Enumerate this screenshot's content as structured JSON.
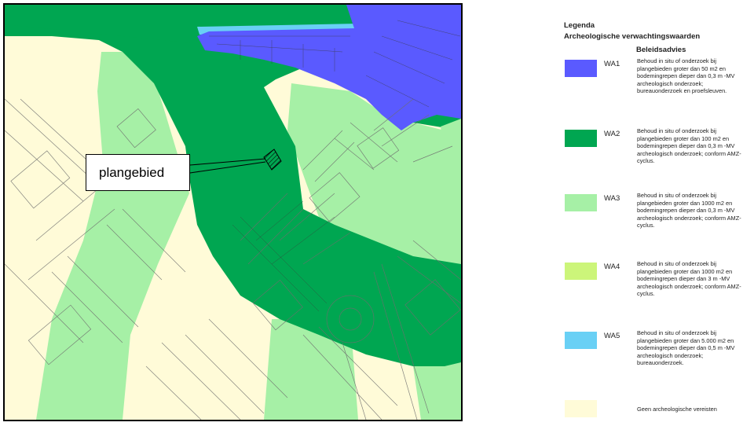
{
  "map": {
    "callout_label": "plangebied",
    "colors": {
      "base": "#fffbd8",
      "wa1": "#5a5aff",
      "wa2": "#00a651",
      "wa3": "#a6f0a6",
      "wa5": "#69d0f5",
      "lines": "#6e6e6e",
      "hatch": "#000000"
    }
  },
  "legend": {
    "title": "Legenda",
    "subtitle": "Archeologische verwachtingswaarden",
    "column_header": "Beleidsadvies",
    "items": [
      {
        "code": "WA1",
        "color": "#5a5aff",
        "description": "Behoud in situ of onderzoek bij plangebieden groter dan 50 m2 en bodemingrepen dieper dan 0,3 m -MV archeologisch onderzoek; bureauonderzoek en proefsleuven."
      },
      {
        "code": "WA2",
        "color": "#00a651",
        "description": "Behoud in situ of onderzoek bij plangebieden groter dan 100 m2 en bodemingrepen dieper dan 0,3 m -MV archeologisch onderzoek; conform AMZ-cyclus."
      },
      {
        "code": "WA3",
        "color": "#a6f0a6",
        "description": "Behoud in situ of onderzoek bij plangebieden groter dan 1000 m2 en bodemingrepen dieper dan 0,3 m -MV archeologisch onderzoek; conform AMZ-cyclus."
      },
      {
        "code": "WA4",
        "color": "#ccf57a",
        "description": "Behoud in situ of onderzoek bij plangebieden groter dan 1000 m2 en bodemingrepen dieper dan 3 m -MV archeologisch onderzoek; conform AMZ-cyclus."
      },
      {
        "code": "WA5",
        "color": "#69d0f5",
        "description": "Behoud in situ of onderzoek bij plangebieden groter dan 5.000 m2 en bodemingrepen dieper dan 0,5 m -MV archeologisch onderzoek; bureauonderzoek."
      },
      {
        "code": "",
        "color": "#fffbd8",
        "description": "Geen archeologische vereisten"
      }
    ]
  }
}
